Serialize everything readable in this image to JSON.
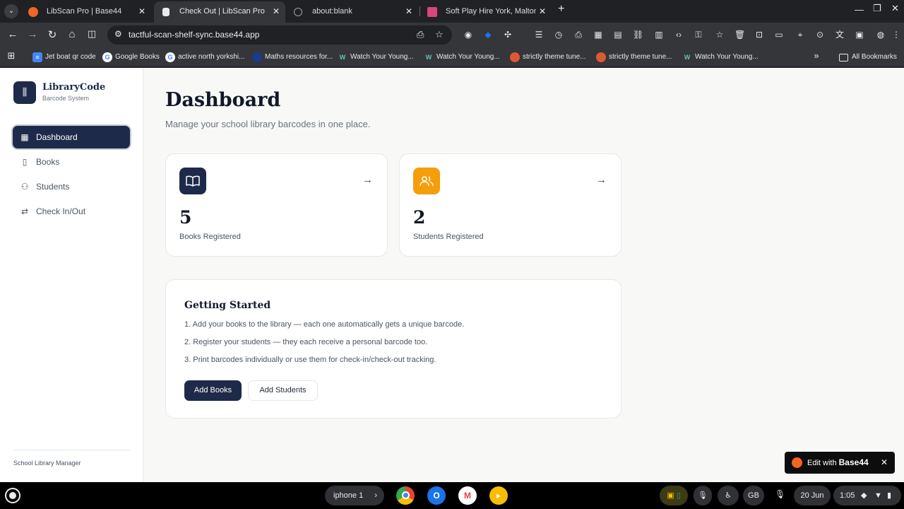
{
  "browser": {
    "tabs": [
      {
        "title": "LibScan Pro | Base44",
        "active": false
      },
      {
        "title": "Check Out | LibScan Pro",
        "active": true
      },
      {
        "title": "about:blank",
        "active": false
      },
      {
        "title": "Soft Play Hire York, Malton, Poc",
        "active": false
      }
    ],
    "url": "tactful-scan-shelf-sync.base44.app",
    "bookmarks": [
      {
        "label": "Jet boat qr code",
        "icon": "docs-icon"
      },
      {
        "label": "Google Books",
        "icon": "google-icon"
      },
      {
        "label": "active north yorkshi...",
        "icon": "google-icon"
      },
      {
        "label": "Maths resources for...",
        "icon": "globe-icon"
      },
      {
        "label": "Watch Your Young...",
        "icon": "wy-icon"
      },
      {
        "label": "Watch Your Young...",
        "icon": "wy-icon"
      },
      {
        "label": "strictly theme tune...",
        "icon": "duckduckgo-icon"
      },
      {
        "label": "strictly theme tune...",
        "icon": "duckduckgo-icon"
      },
      {
        "label": "Watch Your Young...",
        "icon": "wy-icon"
      }
    ],
    "all_bookmarks": "All Bookmarks"
  },
  "sidebar": {
    "brand": "LibraryCode",
    "brand_sub": "Barcode System",
    "items": [
      {
        "label": "Dashboard",
        "icon": "grid-icon",
        "active": true
      },
      {
        "label": "Books",
        "icon": "book-icon",
        "active": false
      },
      {
        "label": "Students",
        "icon": "users-icon",
        "active": false
      },
      {
        "label": "Check In/Out",
        "icon": "swap-icon",
        "active": false
      }
    ],
    "footer": "School Library Manager"
  },
  "main": {
    "title": "Dashboard",
    "subtitle": "Manage your school library barcodes in one place.",
    "stats": [
      {
        "value": "5",
        "label": "Books Registered",
        "color": "#1e2a49",
        "icon": "book-icon"
      },
      {
        "value": "2",
        "label": "Students Registered",
        "color": "#f59e0b",
        "icon": "users-icon"
      }
    ],
    "getting_started": {
      "title": "Getting Started",
      "steps": [
        "1. Add your books to the library — each one automatically gets a unique barcode.",
        "2. Register your students — they each receive a personal barcode too.",
        "3. Print barcodes individually or use them for check-in/check-out tracking."
      ],
      "primary_button": "Add Books",
      "secondary_button": "Add Students"
    }
  },
  "edit_badge": {
    "prefix": "Edit with",
    "brand": "Base44"
  },
  "shelf": {
    "phone_hub": "iphone 1",
    "keyboard": "GB",
    "date": "20 Jun",
    "time": "1:05"
  },
  "colors": {
    "accent": "#1e2a49",
    "amber": "#f59e0b",
    "page_bg": "#f8f8f7"
  }
}
